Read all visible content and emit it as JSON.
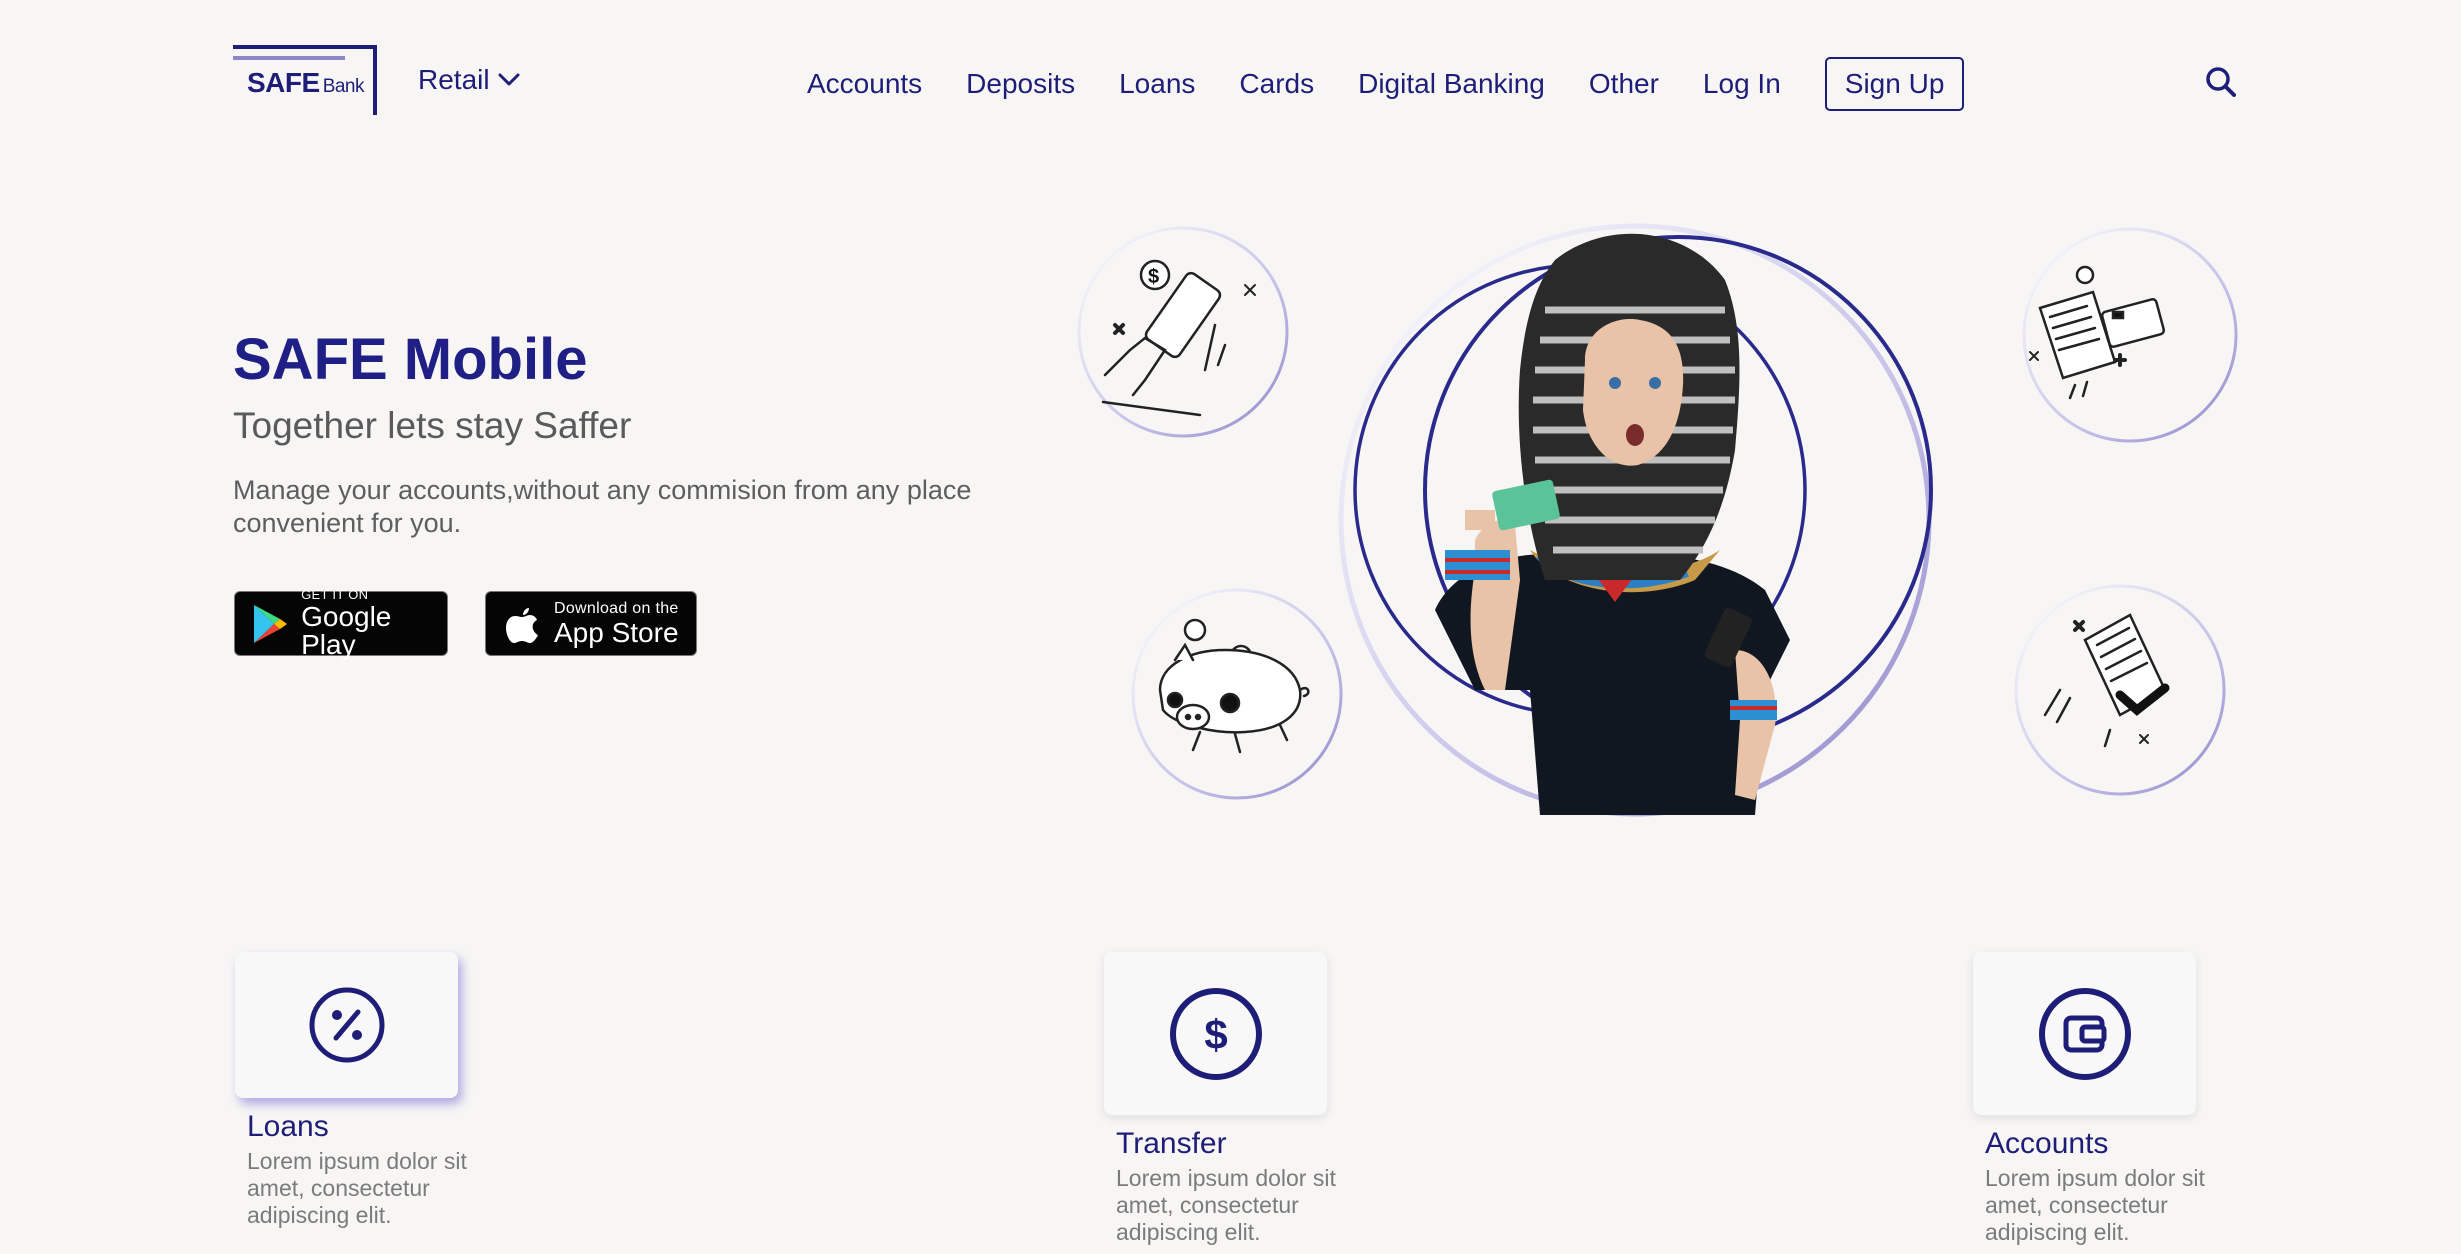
{
  "brand": {
    "name": "SAFE",
    "suffix": "Bank"
  },
  "header": {
    "segment": "Retail",
    "nav": [
      "Accounts",
      "Deposits",
      "Loans",
      "Cards",
      "Digital Banking",
      "Other",
      "Log In"
    ],
    "signup": "Sign Up"
  },
  "hero": {
    "title": "SAFE Mobile",
    "subtitle": "Together lets stay Saffer",
    "description": "Manage your accounts,without any commision from any place convenient for you.",
    "google_play": {
      "small": "GET IT ON",
      "big": "Google Play"
    },
    "app_store": {
      "small": "Download on the",
      "big": "App Store"
    }
  },
  "features": [
    {
      "title": "Loans",
      "description": "Lorem ipsum dolor sit amet, consectetur adipiscing elit.",
      "icon": "percent-icon"
    },
    {
      "title": "Transfer",
      "description": "Lorem ipsum dolor sit amet, consectetur adipiscing elit.",
      "icon": "dollar-icon"
    },
    {
      "title": "Accounts",
      "description": "Lorem ipsum dolor sit amet, consectetur adipiscing elit.",
      "icon": "wallet-icon"
    }
  ],
  "colors": {
    "primary": "#1e1e78",
    "accent": "#8f86c9",
    "background": "#f7f6f5"
  }
}
